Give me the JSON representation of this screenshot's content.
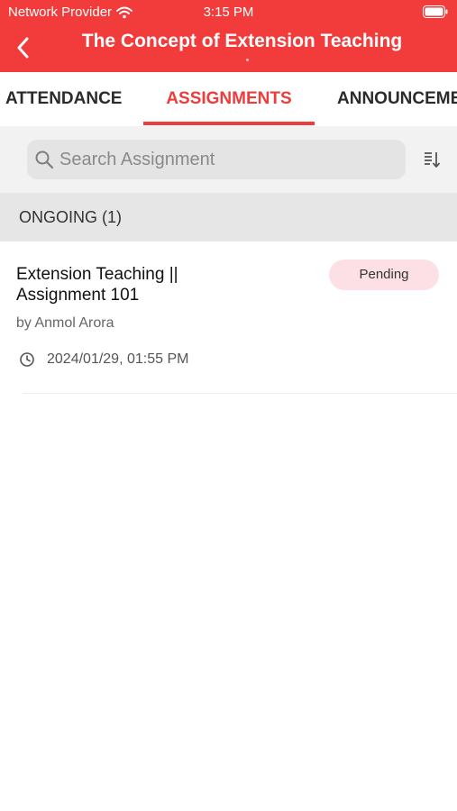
{
  "status_bar": {
    "carrier": "Network Provider",
    "time": "3:15 PM"
  },
  "header": {
    "title": "The Concept of Extension Teaching",
    "back_icon": "chevron-left-icon",
    "background_color": "#f23b3b"
  },
  "tabs": [
    {
      "label": "ATTENDANCE",
      "active": false
    },
    {
      "label": "ASSIGNMENTS",
      "active": true
    },
    {
      "label": "ANNOUNCEMENTS",
      "active": false
    }
  ],
  "search": {
    "placeholder": "Search Assignment",
    "value": "",
    "icon": "search-icon",
    "sort_icon": "sort-icon"
  },
  "sections": [
    {
      "title": "ONGOING (1)",
      "items": [
        {
          "title": "Extension Teaching || Assignment 101",
          "author": "by Anmol Arora",
          "datetime": "2024/01/29, 01:55 PM",
          "status": "Pending",
          "status_color": "#fde0e6"
        }
      ]
    }
  ],
  "colors": {
    "accent": "#ee3b3b",
    "section_bg": "#e6e6e6",
    "search_area_bg": "#f2f2f2"
  }
}
